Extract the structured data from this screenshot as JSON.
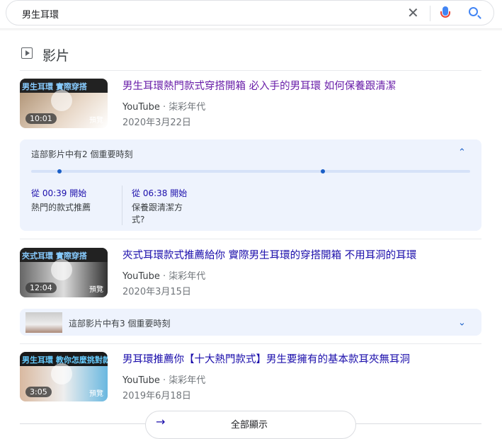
{
  "search": {
    "query": "男生耳環"
  },
  "section": {
    "title": "影片"
  },
  "videos": [
    {
      "title": "男生耳環熱門款式穿搭開箱 必入手的男耳環 如何保養跟清潔",
      "source": "YouTube",
      "channel": "柒彩年代",
      "date": "2020年3月22日",
      "duration": "10:01",
      "banner": "男生耳環 實際穿搭",
      "preview": "預覽"
    },
    {
      "title": "夾式耳環款式推薦給你 實際男生耳環的穿搭開箱 不用耳洞的耳環",
      "source": "YouTube",
      "channel": "柒彩年代",
      "date": "2020年3月15日",
      "duration": "12:04",
      "banner": "夾式耳環 實際穿搭",
      "preview": "預覽"
    },
    {
      "title": "男耳環推薦你【十大熱門款式】男生要擁有的基本款耳夾無耳洞",
      "source": "YouTube",
      "channel": "柒彩年代",
      "date": "2019年6月18日",
      "duration": "3:05",
      "banner": "男生耳環 教你怎麼挑對款!",
      "preview": "預覽"
    }
  ],
  "moments1": {
    "label": "這部影片中有2 個重要時刻",
    "items": [
      {
        "time": "從 00:39 開始",
        "desc": "熱門的款式推薦"
      },
      {
        "time": "從 06:38 開始",
        "desc": "保養跟清潔方式?"
      }
    ],
    "positions": [
      0.065,
      0.665
    ]
  },
  "moments2": {
    "label": "這部影片中有3 個重要時刻"
  },
  "more": {
    "label": "全部顯示"
  },
  "sep": "·"
}
